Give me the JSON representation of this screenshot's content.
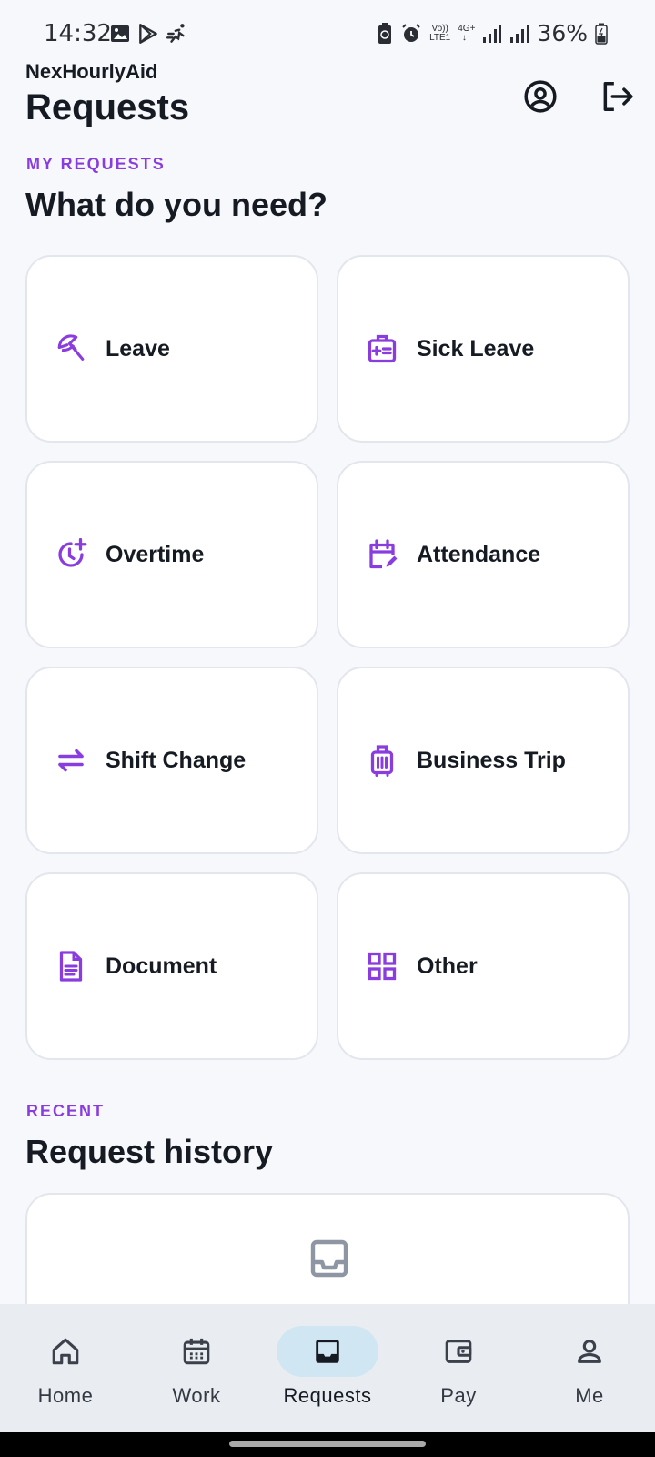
{
  "status_bar": {
    "time": "14:32",
    "left_icons": [
      "image-icon",
      "play-store-icon",
      "running-icon"
    ],
    "right_icons": [
      "battery-saver-icon",
      "alarm-icon",
      "volte-icon",
      "4g-icon",
      "signal-icon",
      "signal-icon"
    ],
    "volte_top": "Vo))",
    "volte_bottom": "LTE1",
    "network": "4G+",
    "battery": "36%"
  },
  "header": {
    "app_name": "NexHourlyAid",
    "title": "Requests",
    "profile_icon": "account-circle-icon",
    "logout_icon": "logout-icon"
  },
  "my_requests": {
    "eyebrow": "MY REQUESTS",
    "title": "What do you need?",
    "items": [
      {
        "label": "Leave",
        "icon": "beach-umbrella-icon"
      },
      {
        "label": "Sick Leave",
        "icon": "medical-id-icon"
      },
      {
        "label": "Overtime",
        "icon": "clock-plus-icon"
      },
      {
        "label": "Attendance",
        "icon": "calendar-edit-icon"
      },
      {
        "label": "Shift Change",
        "icon": "swap-arrows-icon"
      },
      {
        "label": "Business Trip",
        "icon": "luggage-icon"
      },
      {
        "label": "Document",
        "icon": "document-icon"
      },
      {
        "label": "Other",
        "icon": "grid-icon"
      }
    ]
  },
  "recent": {
    "eyebrow": "RECENT",
    "title": "Request history",
    "empty_icon": "inbox-icon"
  },
  "bottom_nav": {
    "items": [
      {
        "label": "Home",
        "icon": "home-icon"
      },
      {
        "label": "Work",
        "icon": "calendar-icon"
      },
      {
        "label": "Requests",
        "icon": "inbox-icon",
        "active": true
      },
      {
        "label": "Pay",
        "icon": "wallet-icon"
      },
      {
        "label": "Me",
        "icon": "person-icon"
      }
    ]
  },
  "colors": {
    "accent": "#8a3ddf",
    "background": "#f7f8fb",
    "nav_background": "#e9edf2",
    "nav_active_pill": "#d0e6f2"
  }
}
